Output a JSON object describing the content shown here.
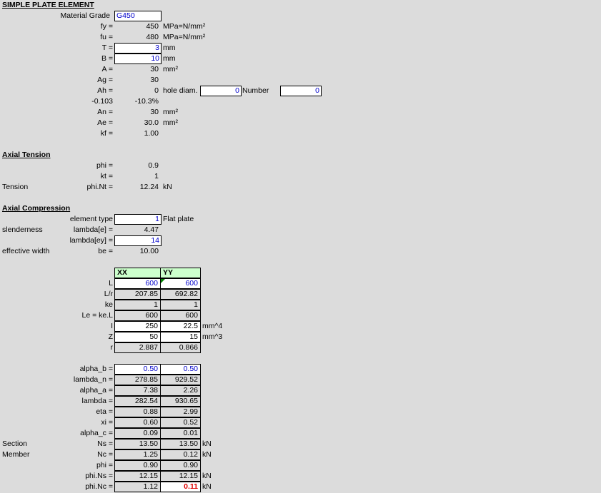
{
  "title": "SIMPLE PLATE ELEMENT",
  "material": {
    "label": "Material Grade",
    "value": "G450"
  },
  "fy": {
    "label": "fy =",
    "value": "450",
    "unit": "MPa=N/mm²"
  },
  "fu": {
    "label": "fu =",
    "value": "480",
    "unit": "MPa=N/mm²"
  },
  "T": {
    "label": "T =",
    "value": "3",
    "unit": "mm"
  },
  "B": {
    "label": "B =",
    "value": "10",
    "unit": "mm"
  },
  "A": {
    "label": "A =",
    "value": "30",
    "unit": "mm²"
  },
  "Ag": {
    "label": "Ag =",
    "value": "30"
  },
  "Ah": {
    "label": "Ah =",
    "value": "0",
    "hole_label": "hole diam.",
    "hole_value": "0",
    "number_label": "Number",
    "number_value": "0"
  },
  "ratio": {
    "a": "-0.103",
    "b": "-10.3%"
  },
  "An": {
    "label": "An =",
    "value": "30",
    "unit": "mm²"
  },
  "Ae": {
    "label": "Ae =",
    "value": "30.0",
    "unit": "mm²"
  },
  "kf": {
    "label": "kf =",
    "value": "1.00"
  },
  "tension": {
    "heading": "Axial Tension",
    "phi": {
      "label": "phi =",
      "value": "0.9"
    },
    "kt": {
      "label": "kt =",
      "value": "1"
    },
    "row_label": "Tension",
    "phiNt": {
      "label": "phi.Nt =",
      "value": "12.24",
      "unit": "kN"
    }
  },
  "compression": {
    "heading": "Axial Compression",
    "element_type": {
      "label": "element type",
      "value": "1",
      "desc": "Flat plate"
    },
    "slenderness": {
      "row_label": "slenderness",
      "label": "lambda[e] =",
      "value": "4.47"
    },
    "lambda_ey": {
      "label": "lambda[ey] =",
      "value": "14"
    },
    "eff_width": {
      "row_label": "effective width",
      "label": "be =",
      "value": "10.00"
    }
  },
  "table1": {
    "headers": [
      "XX",
      "YY"
    ],
    "rows": [
      {
        "label": "L",
        "xx": "600",
        "yy": "600",
        "unit": ""
      },
      {
        "label": "L/r",
        "xx": "207.85",
        "yy": "692.82",
        "unit": ""
      },
      {
        "label": "ke",
        "xx": "1",
        "yy": "1",
        "unit": ""
      },
      {
        "label": "Le = ke.L",
        "xx": "600",
        "yy": "600",
        "unit": ""
      },
      {
        "label": "I",
        "xx": "250",
        "yy": "22.5",
        "unit": "mm^4"
      },
      {
        "label": "Z",
        "xx": "50",
        "yy": "15",
        "unit": "mm^3"
      },
      {
        "label": "r",
        "xx": "2.887",
        "yy": "0.866",
        "unit": ""
      }
    ]
  },
  "table2": {
    "rows": [
      {
        "side": "",
        "label": "alpha_b =",
        "xx": "0.50",
        "yy": "0.50",
        "unit": ""
      },
      {
        "side": "",
        "label": "lambda_n =",
        "xx": "278.85",
        "yy": "929.52",
        "unit": ""
      },
      {
        "side": "",
        "label": "alpha_a =",
        "xx": "7.38",
        "yy": "2.26",
        "unit": ""
      },
      {
        "side": "",
        "label": "lambda =",
        "xx": "282.54",
        "yy": "930.65",
        "unit": ""
      },
      {
        "side": "",
        "label": "eta =",
        "xx": "0.88",
        "yy": "2.99",
        "unit": ""
      },
      {
        "side": "",
        "label": "xi =",
        "xx": "0.60",
        "yy": "0.52",
        "unit": ""
      },
      {
        "side": "",
        "label": "alpha_c =",
        "xx": "0.09",
        "yy": "0.01",
        "unit": ""
      },
      {
        "side": "Section",
        "label": "Ns =",
        "xx": "13.50",
        "yy": "13.50",
        "unit": "kN"
      },
      {
        "side": "Member",
        "label": "Nc =",
        "xx": "1.25",
        "yy": "0.12",
        "unit": "kN"
      },
      {
        "side": "",
        "label": "phi =",
        "xx": "0.90",
        "yy": "0.90",
        "unit": ""
      },
      {
        "side": "",
        "label": "phi.Ns =",
        "xx": "12.15",
        "yy": "12.15",
        "unit": "kN"
      },
      {
        "side": "",
        "label": "phi.Nc =",
        "xx": "1.12",
        "yy": "0.11",
        "unit": "kN"
      }
    ]
  },
  "colors": {
    "background": "#dcdcdc",
    "input_text": "#0000cc",
    "header_fill": "#ccffcc",
    "critical": "#e00000"
  }
}
